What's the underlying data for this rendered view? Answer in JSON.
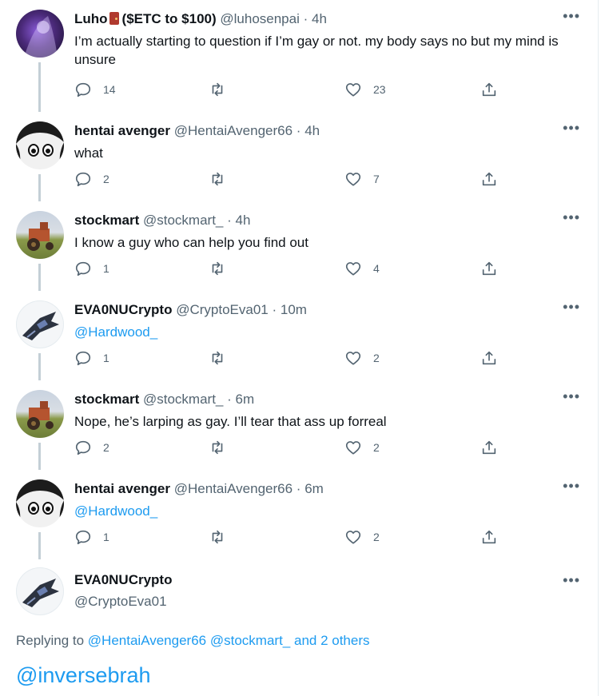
{
  "tweets": [
    {
      "name": "Luho",
      "name_suffix": "($ETC to $100)",
      "handle": "@luhosenpai",
      "dot": "·",
      "time": "4h",
      "text": "I’m actually starting to question if I’m gay or not. my body says no but my mind is unsure",
      "replies": "14",
      "retweets": "",
      "likes": "23"
    },
    {
      "name": "hentai avenger",
      "handle": "@HentaiAvenger66",
      "dot": "·",
      "time": "4h",
      "text": "what",
      "replies": "2",
      "retweets": "",
      "likes": "7"
    },
    {
      "name": "stockmart",
      "handle": "@stockmart_",
      "dot": "·",
      "time": "4h",
      "text": "I know a guy who can help you find out",
      "replies": "1",
      "retweets": "",
      "likes": "4"
    },
    {
      "name": "EVA0NUCrypto",
      "handle": "@CryptoEva01",
      "dot": "·",
      "time": "10m",
      "text": "@Hardwood_",
      "replies": "1",
      "retweets": "",
      "likes": "2"
    },
    {
      "name": "stockmart",
      "handle": "@stockmart_",
      "dot": "·",
      "time": "6m",
      "text": "Nope, he’s larping as gay. I’ll tear that ass up forreal",
      "replies": "2",
      "retweets": "",
      "likes": "2"
    },
    {
      "name": "hentai avenger",
      "handle": "@HentaiAvenger66",
      "dot": "·",
      "time": "6m",
      "text": "@Hardwood_",
      "replies": "1",
      "retweets": "",
      "likes": "2"
    }
  ],
  "composer": {
    "name": "EVA0NUCrypto",
    "handle": "@CryptoEva01"
  },
  "more_label": "•••",
  "replying": {
    "prefix": "Replying to",
    "user1": "@HentaiAvenger66",
    "user2": "@stockmart_",
    "others": "and 2 others"
  },
  "compose_text": "@inversebrah",
  "colors": {
    "link": "#1d9bf0",
    "muted": "#536471",
    "thread_line": "#c4cfd6"
  },
  "icons": [
    "reply-icon",
    "retweet-icon",
    "like-icon",
    "share-icon",
    "more-icon",
    "door-emoji"
  ]
}
